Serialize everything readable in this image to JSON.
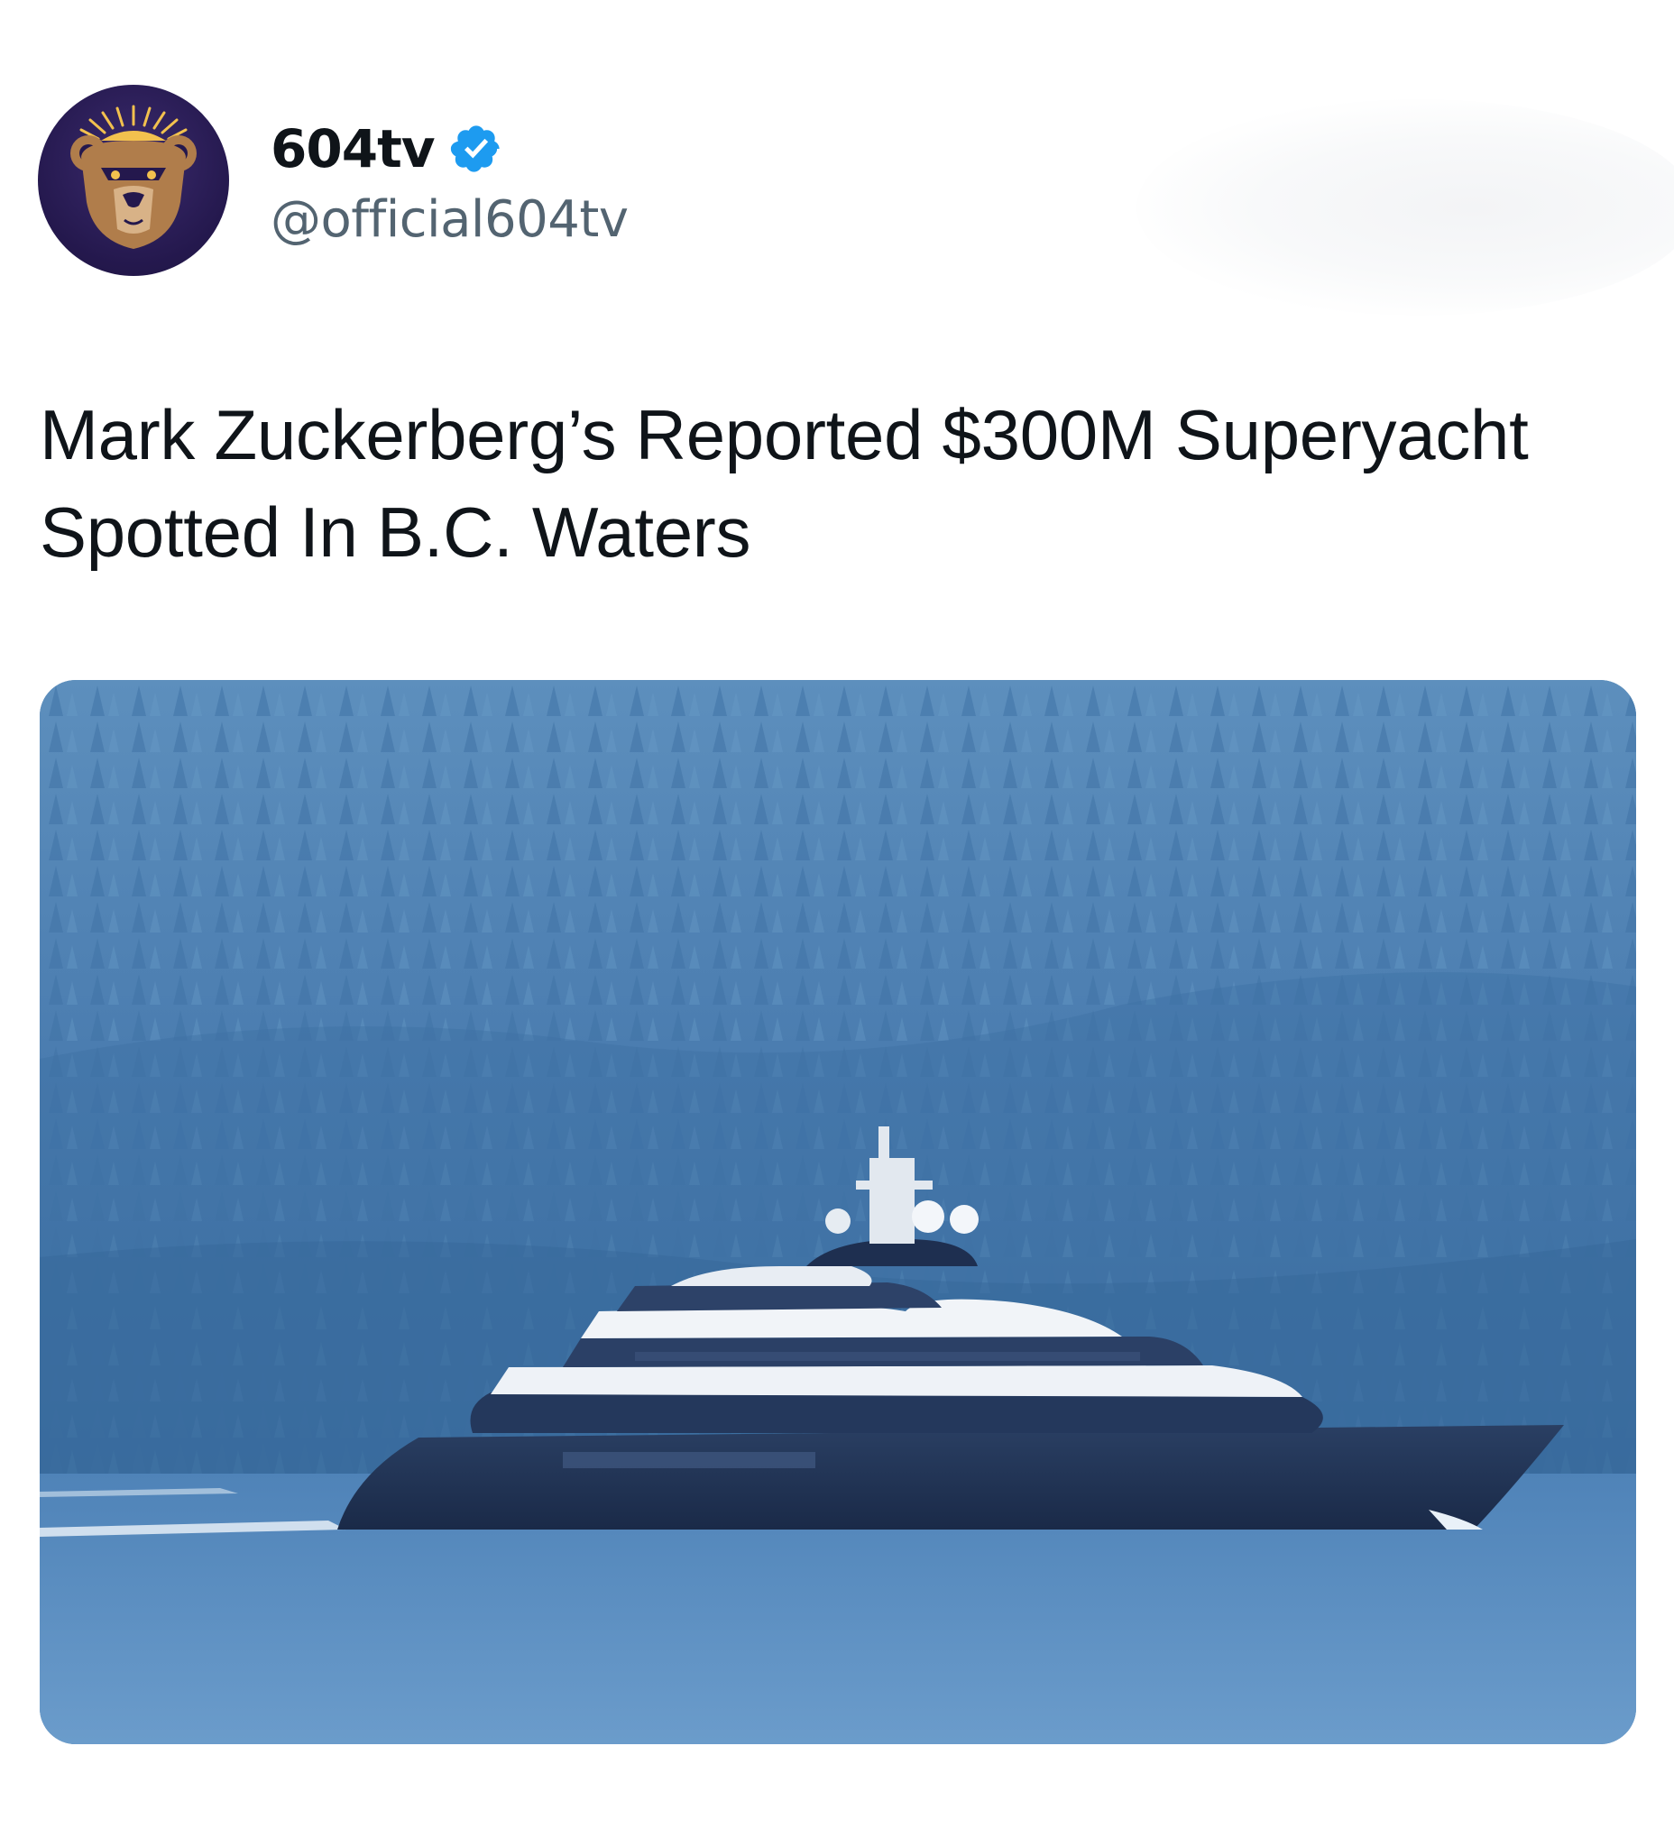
{
  "post": {
    "author": {
      "display_name": "604tv",
      "handle": "@official604tv",
      "verified": true,
      "avatar_icon": "bear-logo-icon",
      "verified_icon": "verified-badge-icon"
    },
    "text": "Mark Zuckerberg’s Reported $300M Superyacht Spotted In B.C. Waters",
    "media": {
      "type": "photo",
      "icon": "superyacht-photo"
    }
  },
  "colors": {
    "text": "#0f1419",
    "secondary_text": "#536471",
    "verified_blue": "#1d9bf0",
    "avatar_bg": "#24184d"
  }
}
